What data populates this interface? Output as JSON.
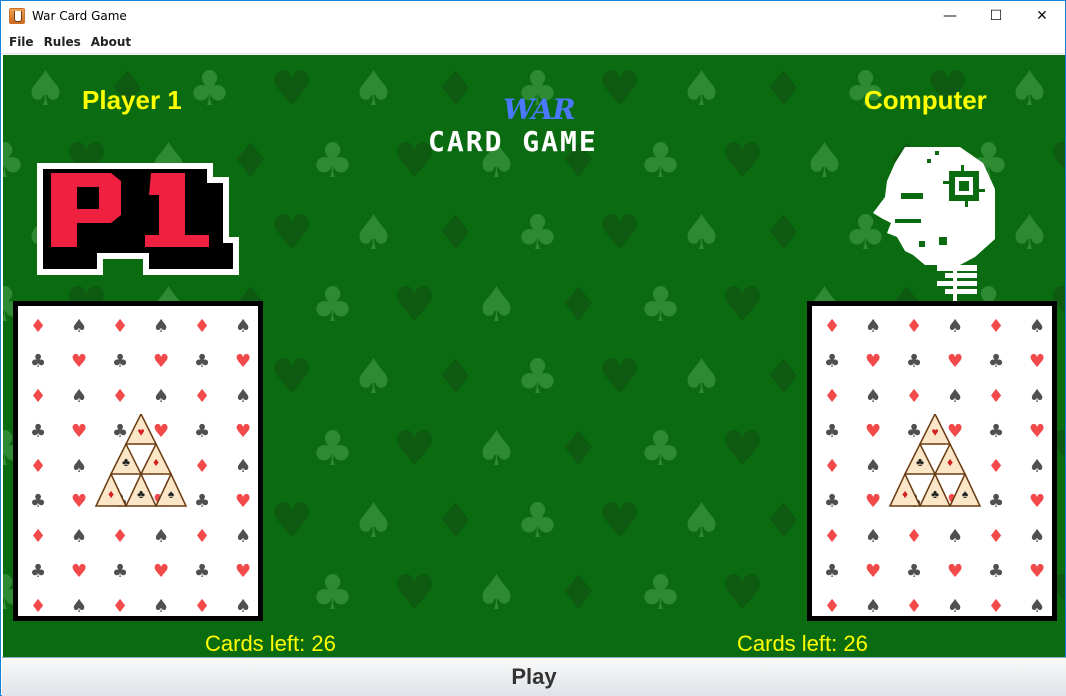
{
  "window": {
    "title": "War Card Game",
    "controls": {
      "minimize": "—",
      "maximize": "☐",
      "close": "✕"
    }
  },
  "menu": [
    {
      "label": "File"
    },
    {
      "label": "Rules"
    },
    {
      "label": "About"
    }
  ],
  "colors": {
    "table_green": "#0a6b10",
    "label_yellow": "#ffff00",
    "logo_blue": "#4a78ff",
    "card_red": "#f24a4a",
    "card_gray": "#505050"
  },
  "board": {
    "logo": {
      "line1": "WAR",
      "line2": "CARD GAME"
    },
    "player": {
      "name": "Player 1",
      "badge": "P1",
      "cards_left": "Cards left: 26",
      "card_back": "house-of-cards-back"
    },
    "computer": {
      "name": "Computer",
      "avatar": "robot-head-icon",
      "cards_left": "Cards left: 26",
      "card_back": "house-of-cards-back"
    }
  },
  "play_button": {
    "label": "Play"
  }
}
